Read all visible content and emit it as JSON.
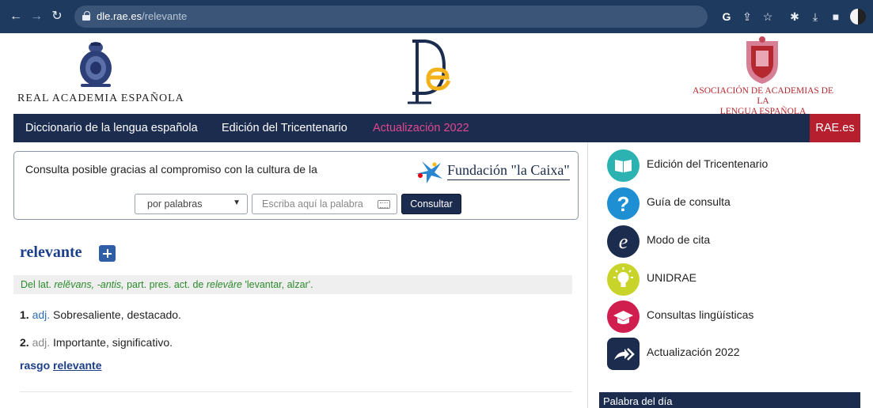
{
  "browser": {
    "url_host": "dle.rae.es",
    "url_path": "/relevante"
  },
  "header": {
    "rae_name": "REAL ACADEMIA ESPAÑOLA",
    "asale_line1": "ASOCIACIÓN DE ACADEMIAS DE LA",
    "asale_line2": "LENGUA ESPAÑOLA"
  },
  "nav": {
    "item1": "Diccionario de la lengua española",
    "item2": "Edición del Tricentenario",
    "item3": "Actualización 2022",
    "rae": "RAE.es"
  },
  "search": {
    "sponsor_text": "Consulta posible gracias al compromiso con la cultura de la",
    "sponsor_name": "Fundación \"la Caixa\"",
    "mode": "por palabras",
    "placeholder": "Escriba aquí la palabra",
    "button": "Consultar"
  },
  "entry": {
    "word": "relevante",
    "etym_prefix": "Del lat. ",
    "etym_latin1": "relĕvans, -antis,",
    "etym_mid": " part. pres. act. de ",
    "etym_latin2": "relevāre",
    "etym_suffix": " 'levantar, alzar'.",
    "defs": [
      {
        "num": "1.",
        "abbr": "adj.",
        "text": "Sobresaliente, destacado."
      },
      {
        "num": "2.",
        "abbr": "adj.",
        "text": "Importante, significativo."
      }
    ],
    "rasgo_prefix": "rasgo",
    "rasgo_link": "relevante"
  },
  "sidebar": {
    "items": [
      {
        "label": "Edición del Tricentenario",
        "color": "#2cb3b1",
        "icon": "book-icon"
      },
      {
        "label": "Guía de consulta",
        "color": "#1e8fd3",
        "icon": "question-icon"
      },
      {
        "label": "Modo de cita",
        "color": "#1b2c4f",
        "icon": "e-letter-icon"
      },
      {
        "label": "UNIDRAE",
        "color": "#c9d42a",
        "icon": "lightbulb-icon"
      },
      {
        "label": "Consultas lingüísticas",
        "color": "#d01f4f",
        "icon": "graduation-cap-icon"
      },
      {
        "label": "Actualización 2022",
        "color": "#1b2c4f",
        "icon": "fast-forward-arrow-icon"
      }
    ],
    "palabra_dia": "Palabra del día"
  }
}
